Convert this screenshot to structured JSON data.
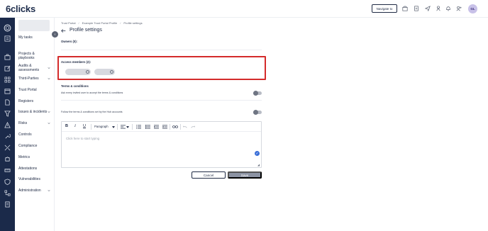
{
  "app": {
    "logo": "6clicks"
  },
  "topbar": {
    "navigate_label": "Navigate to",
    "icons": [
      "building-icon",
      "report-icon",
      "send-icon",
      "hat-icon",
      "bell-icon",
      "user-add-icon",
      "settings-icon"
    ],
    "avatar_initials": "GL"
  },
  "rail": {
    "icons": [
      "home-circle-icon",
      "list-icon",
      "briefcase-icon",
      "edit-icon",
      "grid-icon",
      "calendar-icon",
      "document-icon",
      "filter-icon",
      "warning-icon",
      "wrench-icon",
      "tools-icon",
      "puzzle-icon",
      "ruler-icon",
      "shield-icon",
      "flow-icon",
      "doc-text-icon"
    ]
  },
  "sidebar": {
    "items": [
      {
        "label": "My tasks",
        "chevron": false
      },
      {
        "label": "Projects & playbooks",
        "chevron": false
      },
      {
        "label": "Audits & assessments",
        "chevron": true
      },
      {
        "label": "Third-Parties",
        "chevron": true
      },
      {
        "label": "Trust Portal",
        "chevron": false
      },
      {
        "label": "Registers",
        "chevron": false
      },
      {
        "label": "Issues & incidents",
        "chevron": true
      },
      {
        "label": "Risks",
        "chevron": true
      },
      {
        "label": "Controls",
        "chevron": false
      },
      {
        "label": "Compliance",
        "chevron": false
      },
      {
        "label": "Metrics",
        "chevron": false
      },
      {
        "label": "Attestations",
        "chevron": false
      },
      {
        "label": "Vulnerabilities",
        "chevron": false
      },
      {
        "label": "Administration",
        "chevron": true
      }
    ]
  },
  "breadcrumb": [
    "Trust Portal",
    "Example Trust Portal Profile",
    "Profile settings"
  ],
  "page": {
    "title": "Profile settings",
    "owners_label": "Owners (0):",
    "access_label": "Access members (2):",
    "terms_label": "Terms & conditions",
    "terms_toggle_text": "Ask every invited user to accept the terms & conditions",
    "follow_toggle_text": "Follow the terms & conditions set by the Hub accounts",
    "editor_placeholder": "Click here to start typing",
    "paragraph_label": "Paragraph",
    "cancel_label": "Cancel",
    "save_label": "Save"
  },
  "colors": {
    "rail": "#1b2a4a",
    "highlight": "#d42b2b",
    "accent": "#3b6fd8"
  }
}
